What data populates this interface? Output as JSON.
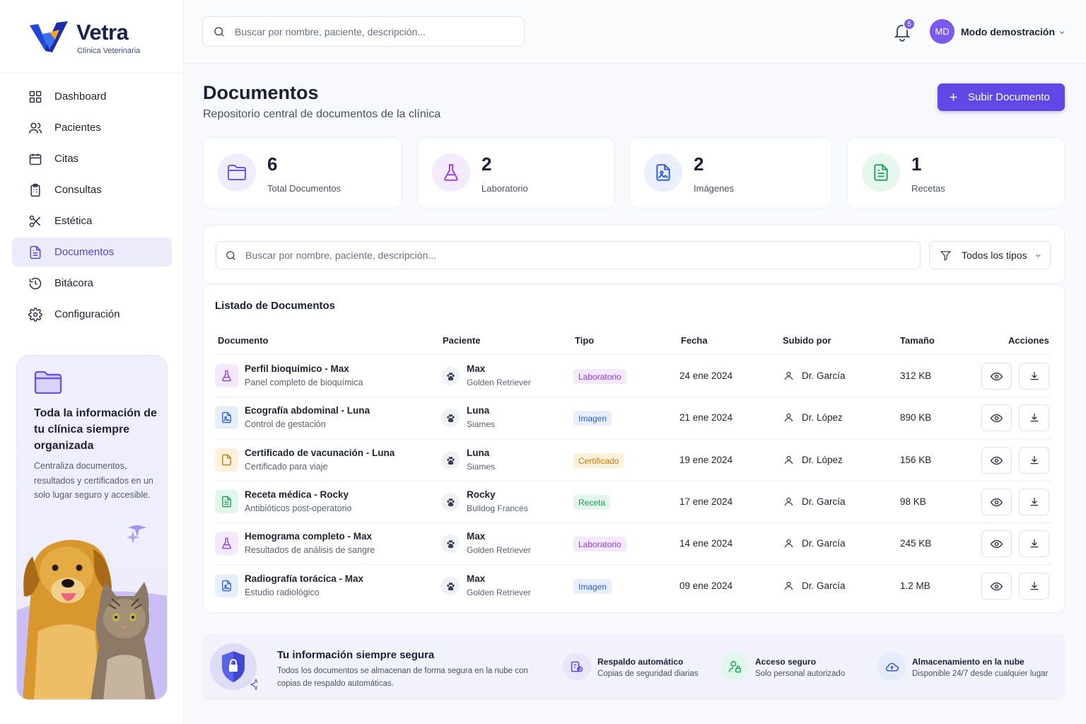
{
  "brand": {
    "name": "Vetra",
    "subtitle": "Clínica Veterinaria"
  },
  "nav": [
    {
      "label": "Dashboard",
      "icon": "dashboard-icon"
    },
    {
      "label": "Pacientes",
      "icon": "users-icon"
    },
    {
      "label": "Citas",
      "icon": "calendar-icon"
    },
    {
      "label": "Consultas",
      "icon": "clipboard-icon"
    },
    {
      "label": "Estética",
      "icon": "scissors-icon"
    },
    {
      "label": "Documentos",
      "icon": "document-icon",
      "active": true
    },
    {
      "label": "Bitácora",
      "icon": "history-icon"
    },
    {
      "label": "Configuración",
      "icon": "gear-icon"
    }
  ],
  "promo": {
    "title": "Toda la información de tu clínica siempre organizada",
    "text": "Centraliza documentos, resultados y certificados en un solo lugar seguro y accesible."
  },
  "topbar": {
    "search_placeholder": "Buscar por nombre, paciente, descripción...",
    "notifications": "5",
    "avatar_initials": "MD",
    "user_name": "Modo demostración"
  },
  "page": {
    "title": "Documentos",
    "subtitle": "Repositorio central de documentos de la clínica",
    "upload_label": "Subir Documento"
  },
  "stats": [
    {
      "value": "6",
      "label": "Total Documentos",
      "icon": "folder-icon",
      "color": "#6b55e8",
      "bg": "#efedfd"
    },
    {
      "value": "2",
      "label": "Laboratorio",
      "icon": "flask-icon",
      "color": "#9b3fe0",
      "bg": "#f4eafd"
    },
    {
      "value": "2",
      "label": "Imágenes",
      "icon": "image-file-icon",
      "color": "#2f5fe0",
      "bg": "#e9effd"
    },
    {
      "value": "1",
      "label": "Recetas",
      "icon": "prescription-icon",
      "color": "#1ea45c",
      "bg": "#e6f7ee"
    }
  ],
  "filters": {
    "search_placeholder": "Buscar por nombre, paciente, descripción...",
    "type_label": "Todos los tipos"
  },
  "table": {
    "title": "Listado de Documentos",
    "headers": [
      "Documento",
      "Paciente",
      "Tipo",
      "Fecha",
      "Subido por",
      "Tamaño",
      "Acciones"
    ],
    "rows": [
      {
        "name": "Perfil bioquímico - Max",
        "desc": "Panel completo de bioquímica",
        "patient": "Max",
        "breed": "Golden Retriever",
        "type": "Laboratorio",
        "date": "24 ene 2024",
        "by": "Dr. García",
        "size": "312 KB"
      },
      {
        "name": "Ecografía abdominal - Luna",
        "desc": "Control de gestación",
        "patient": "Luna",
        "breed": "Siames",
        "type": "Imagen",
        "date": "21 ene 2024",
        "by": "Dr. López",
        "size": "890 KB"
      },
      {
        "name": "Certificado de vacunación - Luna",
        "desc": "Certificado para viaje",
        "patient": "Luna",
        "breed": "Siames",
        "type": "Certificado",
        "date": "19 ene 2024",
        "by": "Dr. López",
        "size": "156 KB"
      },
      {
        "name": "Receta médica - Rocky",
        "desc": "Antibióticos post-operatorio",
        "patient": "Rocky",
        "breed": "Bulldog Francés",
        "type": "Receta",
        "date": "17 ene 2024",
        "by": "Dr. García",
        "size": "98 KB"
      },
      {
        "name": "Hemograma completo - Max",
        "desc": "Resultados de análisis de sangre",
        "patient": "Max",
        "breed": "Golden Retriever",
        "type": "Laboratorio",
        "date": "14 ene 2024",
        "by": "Dr. García",
        "size": "245 KB"
      },
      {
        "name": "Radiografía torácica - Max",
        "desc": "Estudio radiológico",
        "patient": "Max",
        "breed": "Golden Retriever",
        "type": "Imagen",
        "date": "09 ene 2024",
        "by": "Dr. García",
        "size": "1.2 MB"
      }
    ]
  },
  "type_styles": {
    "Laboratorio": {
      "color": "#8a3fd6",
      "bg": "#f3e8fd",
      "icon": "flask-icon"
    },
    "Imagen": {
      "color": "#2f5fe0",
      "bg": "#e7eefd",
      "icon": "image-file-icon"
    },
    "Certificado": {
      "color": "#c27a0e",
      "bg": "#fdf1dc",
      "icon": "certificate-icon"
    },
    "Receta": {
      "color": "#1a9a55",
      "bg": "#e2f6eb",
      "icon": "prescription-icon"
    }
  },
  "security": {
    "title": "Tu información siempre segura",
    "text": "Todos los documentos se almacenan de forma segura en la nube con copias de respaldo automáticas.",
    "features": [
      {
        "title": "Respaldo automático",
        "desc": "Copias de seguridad diarias",
        "icon": "backup-icon",
        "color": "#5a45d8",
        "bg": "#e7e6fa"
      },
      {
        "title": "Acceso seguro",
        "desc": "Solo personal autorizado",
        "icon": "user-lock-icon",
        "color": "#1ea45c",
        "bg": "#e2f6eb"
      },
      {
        "title": "Almacenamiento en la nube",
        "desc": "Disponible 24/7 desde cualquier lugar",
        "icon": "cloud-icon",
        "color": "#2f5fe0",
        "bg": "#e5ebfb"
      }
    ]
  }
}
